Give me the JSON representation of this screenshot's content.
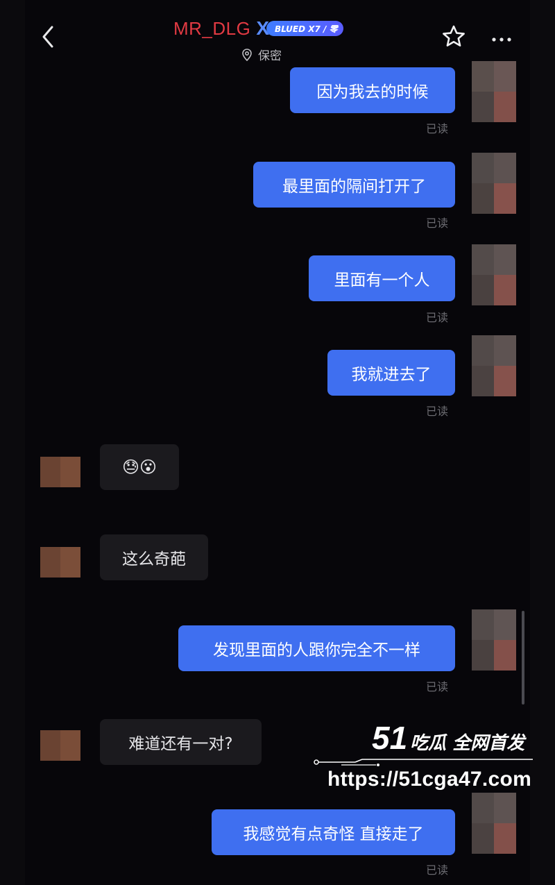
{
  "header": {
    "title": "MR_DLG",
    "badge_letter": "X",
    "badge_text": "BLUED X7 / 零",
    "location": "保密",
    "back_icon": "chevron-left-icon",
    "star_icon": "star-icon",
    "more_icon": "more-horizontal-icon"
  },
  "messages": [
    {
      "side": "out",
      "text": "因为我去的时候",
      "status": "已读"
    },
    {
      "side": "out",
      "text": "最里面的隔间打开了",
      "status": "已读"
    },
    {
      "side": "out",
      "text": "里面有一个人",
      "status": "已读"
    },
    {
      "side": "out",
      "text": "我就进去了",
      "status": "已读"
    },
    {
      "side": "in",
      "text": "😓😮"
    },
    {
      "side": "in",
      "text": "这么奇葩"
    },
    {
      "side": "out",
      "text": "发现里面的人跟你完全不一样",
      "status": "已读"
    },
    {
      "side": "in",
      "text": "难道还有一对?"
    },
    {
      "side": "out",
      "text": "我感觉有点奇怪 直接走了",
      "status": "已读"
    }
  ],
  "watermark": {
    "number": "51",
    "name": "吃瓜 全网首发",
    "url": "https://51cga47.com"
  },
  "colors": {
    "outgoing_bubble": "#3f6ff0",
    "incoming_bubble": "#1b1a1e",
    "title": "#e23a43",
    "badge": "#4f6dff"
  }
}
